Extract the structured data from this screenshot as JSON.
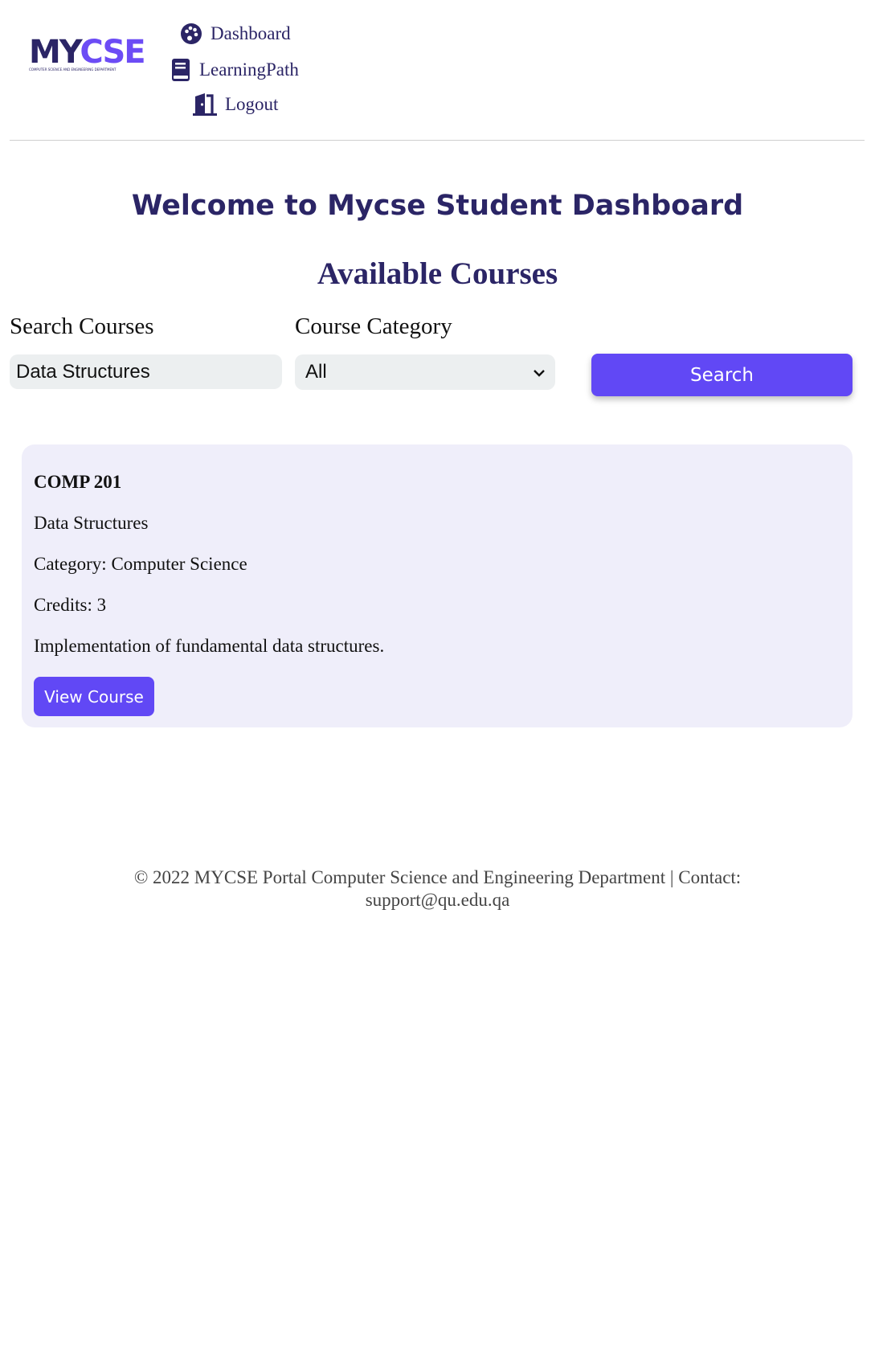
{
  "brand": {
    "logo_my": "MY",
    "logo_cse": "CSE",
    "logo_subtitle": "COMPUTER SCIENCE AND ENGINEERING DEPARTMENT"
  },
  "nav": {
    "dashboard": "Dashboard",
    "learning_path": "LearningPath",
    "logout": "Logout"
  },
  "main": {
    "welcome": "Welcome to Mycse Student Dashboard",
    "available": "Available Courses"
  },
  "filters": {
    "search_label": "Search Courses",
    "search_value": "Data Structures",
    "category_label": "Course Category",
    "category_selected": "All",
    "search_button": "Search"
  },
  "courses": [
    {
      "code": "COMP 201",
      "name": "Data Structures",
      "category": "Category: Computer Science",
      "credits": "Credits: 3",
      "description": "Implementation of fundamental data structures.",
      "view_button": "View Course"
    }
  ],
  "footer": {
    "text": "© 2022 MYCSE Portal Computer Science and Engineering Department | Contact: support@qu.edu.qa"
  },
  "colors": {
    "primary": "#6148f5",
    "navy": "#2b2566",
    "card_bg": "#efeefa",
    "input_bg": "#eceff0"
  },
  "icons": {
    "dashboard": "palette-icon",
    "learning_path": "book-icon",
    "logout": "door-open-icon",
    "select": "chevron-down-icon"
  }
}
